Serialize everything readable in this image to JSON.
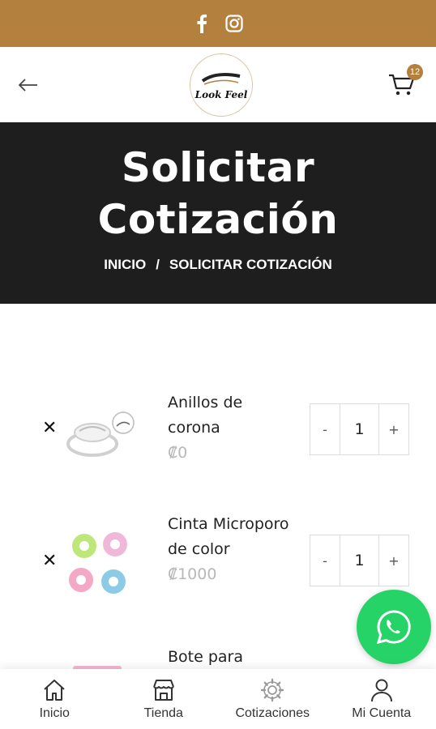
{
  "topbar": {
    "icons": [
      "facebook-icon",
      "instagram-icon"
    ],
    "color": "#b3803d"
  },
  "header": {
    "logo_text": "Look Feel",
    "cart_count": "12"
  },
  "hero": {
    "title_line1": "Solicitar",
    "title_line2": "Cotización",
    "breadcrumb_home": "INICIO",
    "breadcrumb_sep": "/",
    "breadcrumb_current": "SOLICITAR COTIZACIÓN"
  },
  "items": [
    {
      "name": "Anillos de corona",
      "price": "₡0",
      "qty": "1",
      "minus": "-",
      "plus": "+",
      "remove": "✕"
    },
    {
      "name": "Cinta Microporo de color",
      "price": "₡1000",
      "qty": "1",
      "minus": "-",
      "plus": "+",
      "remove": "✕"
    },
    {
      "name": "Bote para"
    }
  ],
  "nav": [
    {
      "label": "Inicio",
      "icon": "home-icon"
    },
    {
      "label": "Tienda",
      "icon": "store-icon"
    },
    {
      "label": "Cotizaciones",
      "icon": "gear-icon"
    },
    {
      "label": "Mi Cuenta",
      "icon": "user-icon"
    }
  ],
  "colors": {
    "accent": "#b3803d",
    "hero_bg": "#1e1e1e",
    "whatsapp": "#25d366"
  }
}
